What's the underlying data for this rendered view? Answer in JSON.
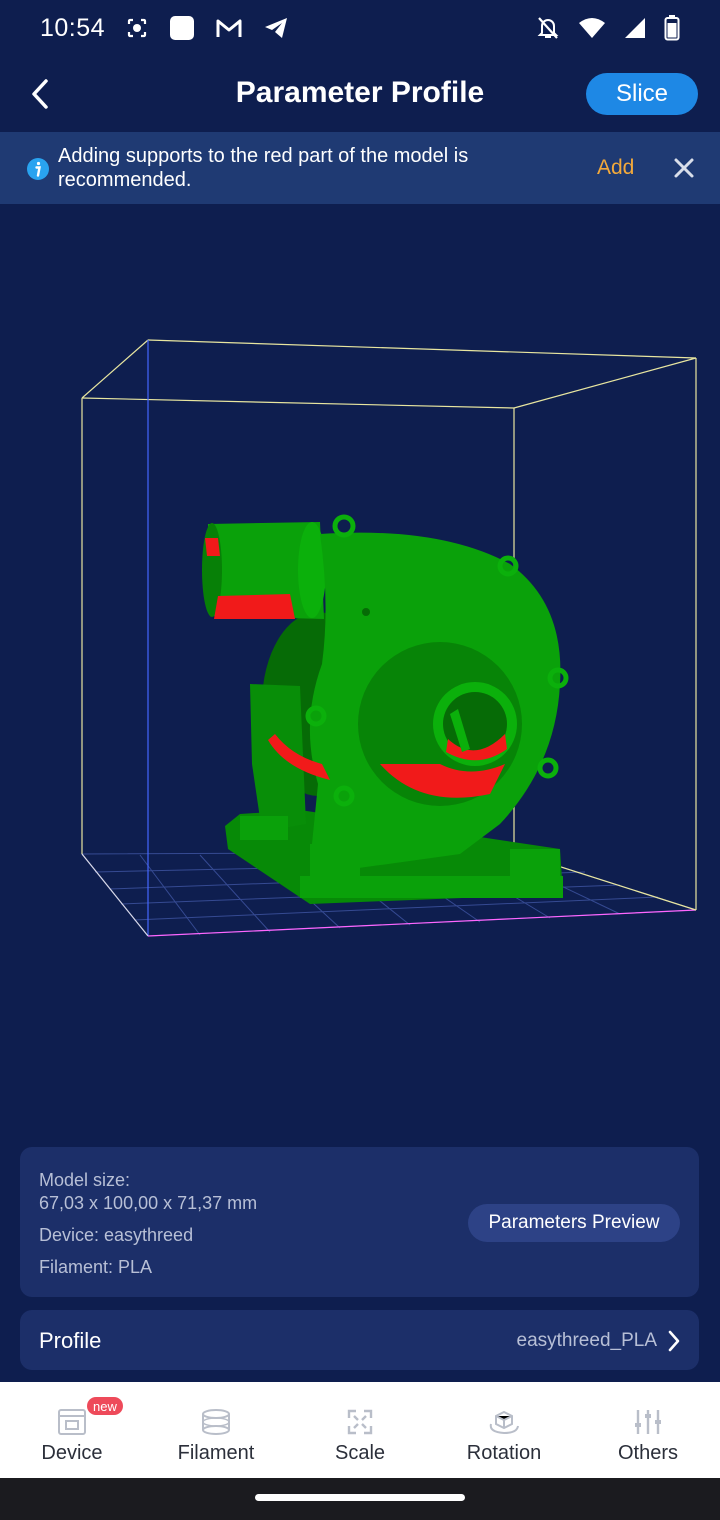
{
  "status_bar": {
    "time": "10:54",
    "icons": [
      "screen-record-icon",
      "square-app-icon",
      "gmail-icon",
      "telegram-icon",
      "notifications-off-icon",
      "wifi-icon",
      "cellular-icon",
      "battery-icon"
    ]
  },
  "header": {
    "title": "Parameter Profile",
    "slice_label": "Slice"
  },
  "notice": {
    "text": "Adding supports to the red part of the model is recommended.",
    "add_label": "Add"
  },
  "info_card": {
    "model_size_label": "Model size:",
    "model_size_value": "67,03 x 100,00 x 71,37 mm",
    "device": "Device: easythreed",
    "filament": "Filament: PLA",
    "params_preview_label": "Parameters Preview"
  },
  "profile": {
    "label": "Profile",
    "value": "easythreed_PLA"
  },
  "bottom_nav": {
    "items": [
      {
        "label": "Device",
        "icon": "device-icon",
        "badge": "new"
      },
      {
        "label": "Filament",
        "icon": "filament-icon"
      },
      {
        "label": "Scale",
        "icon": "scale-icon"
      },
      {
        "label": "Rotation",
        "icon": "rotation-icon"
      },
      {
        "label": "Others",
        "icon": "sliders-icon"
      }
    ]
  },
  "colors": {
    "background": "#0e1e4f",
    "banner": "#1f3a73",
    "accent": "#1e88e5",
    "add_link": "#f3a93b",
    "model_green": "#0aa10a",
    "model_red": "#f11a1a"
  }
}
